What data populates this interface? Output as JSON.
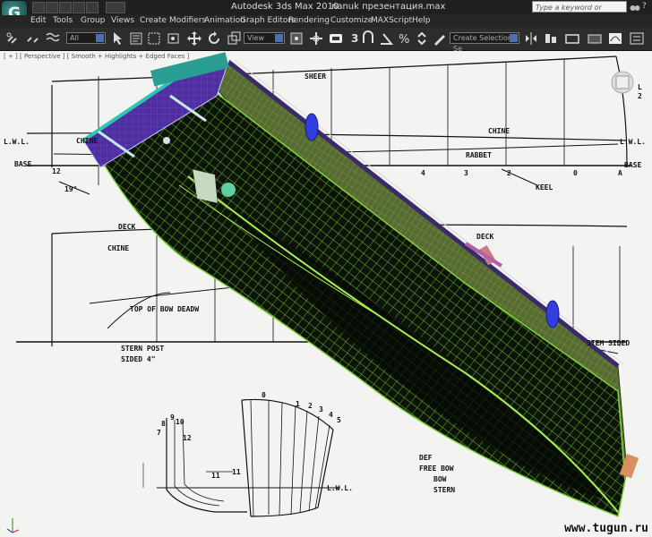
{
  "titlebar": {
    "app_title": "Autodesk 3ds Max  2010",
    "file_name": "nanuk презентация.max",
    "search_placeholder": "Type a keyword or phrase"
  },
  "menu": {
    "items": [
      "Edit",
      "Tools",
      "Group",
      "Views",
      "Create",
      "Modifiers",
      "Animation",
      "Graph Editors",
      "Rendering",
      "Customize",
      "MAXScript",
      "Help"
    ]
  },
  "toolbar": {
    "selection_filter": "All",
    "reference_coord": "View",
    "snap_value": "3",
    "named_selection": "Create Selection Se"
  },
  "viewport": {
    "label": "[ + ] [ Perspective ] [ Smooth + Highlights + Edged Faces ]",
    "watermark": "www.tugun.ru"
  },
  "blueprint": {
    "labels": {
      "sheer": "SHEER",
      "lwl_left": "L.W.L.",
      "lwl_right": "L.W.L.",
      "chine_top": "CHINE",
      "chine_left": "CHINE",
      "base_left": "BASE",
      "base_right": "BASE",
      "rabbet": "RABBET",
      "keel": "KEEL",
      "deck_left": "DECK",
      "deck_right": "DECK",
      "chine_lower": "CHINE",
      "top_bow": "TOP OF BOW DEADW",
      "stern_post": "STERN POST",
      "sided_4": "SIDED 4\"",
      "stern_sided": "STEM SIDED",
      "angle": "19°",
      "bottom_right_1": "DEF",
      "bottom_right_2": "FREE BOW",
      "bottom_right_3": "BOW",
      "bottom_right_4": "STERN",
      "lwl_body": "L.W.L.",
      "num_12": "12",
      "num_11": "11",
      "station_0": "0",
      "station_1": "1",
      "station_2": "2",
      "station_3": "3",
      "station_4": "4",
      "station_5": "5",
      "station_a": "A",
      "st_0": "0",
      "st_1": "1",
      "st_2": "2",
      "st_3": "3",
      "st_4": "4",
      "st_5": "5",
      "st_7": "7",
      "st_8": "8",
      "st_9": "9",
      "st_10": "10",
      "st_11": "11",
      "st_12": "12",
      "side_L": "L",
      "side_2": "2"
    }
  }
}
